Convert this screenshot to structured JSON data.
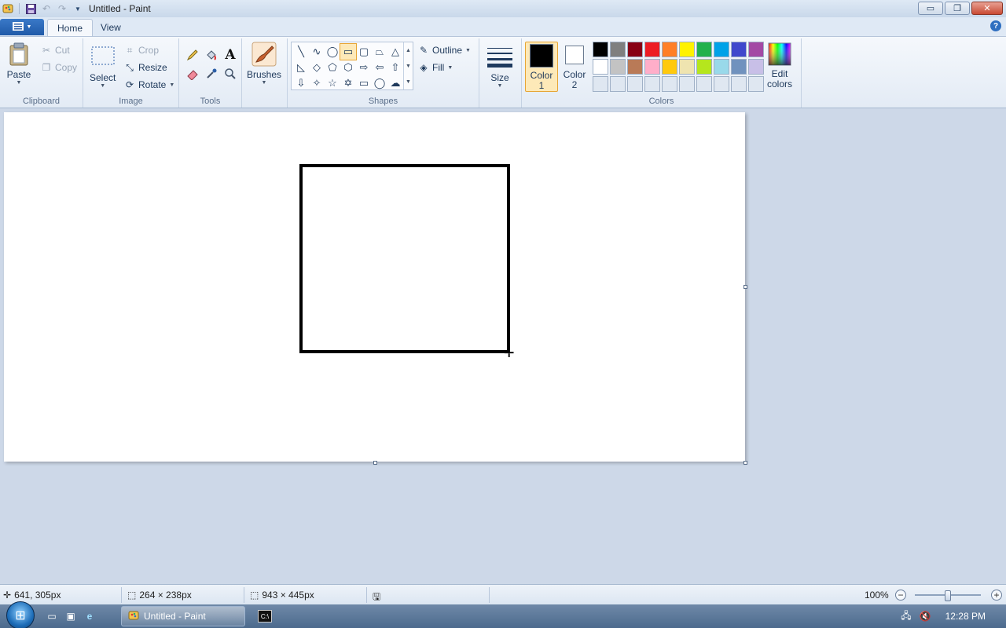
{
  "window": {
    "title": "Untitled - Paint",
    "minimize_glyph": "▭",
    "restore_glyph": "❐",
    "close_glyph": "✕"
  },
  "tabs": [
    {
      "label": "Home",
      "active": true
    },
    {
      "label": "View",
      "active": false
    }
  ],
  "ribbon": {
    "clipboard": {
      "label": "Clipboard",
      "paste": "Paste",
      "cut": "Cut",
      "copy": "Copy"
    },
    "image": {
      "label": "Image",
      "select": "Select",
      "crop": "Crop",
      "resize": "Resize",
      "rotate": "Rotate"
    },
    "tools": {
      "label": "Tools",
      "items": [
        "pencil-icon",
        "fill-bucket-icon",
        "text-icon",
        "eraser-icon",
        "color-picker-icon",
        "magnifier-icon"
      ]
    },
    "brushes": {
      "label": "Brushes"
    },
    "shapes": {
      "label": "Shapes",
      "outline": "Outline",
      "fill": "Fill",
      "items": [
        {
          "name": "line",
          "glyph": "╲"
        },
        {
          "name": "curve",
          "glyph": "∿"
        },
        {
          "name": "oval",
          "glyph": "◯"
        },
        {
          "name": "rectangle",
          "glyph": "▭",
          "selected": true
        },
        {
          "name": "rounded-rectangle",
          "glyph": "▢"
        },
        {
          "name": "polygon",
          "glyph": "⏢"
        },
        {
          "name": "triangle",
          "glyph": "△"
        },
        {
          "name": "right-triangle",
          "glyph": "◺"
        },
        {
          "name": "diamond",
          "glyph": "◇"
        },
        {
          "name": "pentagon",
          "glyph": "⬠"
        },
        {
          "name": "hexagon",
          "glyph": "⬡"
        },
        {
          "name": "right-arrow",
          "glyph": "⇨"
        },
        {
          "name": "left-arrow",
          "glyph": "⇦"
        },
        {
          "name": "up-arrow",
          "glyph": "⇧"
        },
        {
          "name": "down-arrow",
          "glyph": "⇩"
        },
        {
          "name": "four-point-star",
          "glyph": "✧"
        },
        {
          "name": "five-point-star",
          "glyph": "☆"
        },
        {
          "name": "six-point-star",
          "glyph": "✡"
        },
        {
          "name": "rounded-callout",
          "glyph": "▭"
        },
        {
          "name": "oval-callout",
          "glyph": "◯"
        },
        {
          "name": "cloud-callout",
          "glyph": "☁"
        }
      ]
    },
    "size": {
      "label": "Size"
    },
    "colors": {
      "label": "Colors",
      "color1_line1": "Color",
      "color1_line2": "1",
      "color2_line1": "Color",
      "color2_line2": "2",
      "color1": "#000000",
      "color2": "#ffffff",
      "edit_line1": "Edit",
      "edit_line2": "colors",
      "palette_row1": [
        "#000000",
        "#7f7f7f",
        "#880015",
        "#ed1c24",
        "#ff7f27",
        "#fff200",
        "#22b14c",
        "#00a2e8",
        "#3f48cc",
        "#a349a4"
      ],
      "palette_row2": [
        "#ffffff",
        "#c3c3c3",
        "#b97a57",
        "#ffaec9",
        "#ffc90e",
        "#efe4b0",
        "#b5e61d",
        "#99d9ea",
        "#7092be",
        "#c8bfe7"
      ],
      "palette_row3": [
        "#dfe7f1",
        "#dfe7f1",
        "#dfe7f1",
        "#dfe7f1",
        "#dfe7f1",
        "#dfe7f1",
        "#dfe7f1",
        "#dfe7f1",
        "#dfe7f1",
        "#dfe7f1"
      ]
    }
  },
  "status": {
    "cursor_pos": "641, 305px",
    "selection_size": "264 × 238px",
    "canvas_size": "943 × 445px",
    "zoom": "100%",
    "zoom_fraction": 0.5
  },
  "taskbar": {
    "task_label": "Untitled - Paint",
    "time": "12:28 PM"
  }
}
